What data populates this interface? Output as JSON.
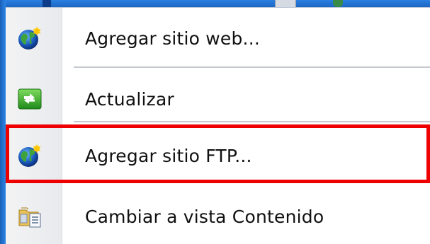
{
  "menu": {
    "items": [
      {
        "label": "Agregar sitio web...",
        "icon": "globe-add-icon"
      },
      {
        "label": "Actualizar",
        "icon": "refresh-icon"
      },
      {
        "label": "Agregar sitio FTP...",
        "icon": "globe-add-icon",
        "highlighted": true
      },
      {
        "label": "Cambiar a vista Contenido",
        "icon": "content-view-icon"
      }
    ]
  },
  "colors": {
    "highlight_border": "#ee0000",
    "desktop": "#1f6fcf",
    "menu_background": "#ffffff"
  }
}
